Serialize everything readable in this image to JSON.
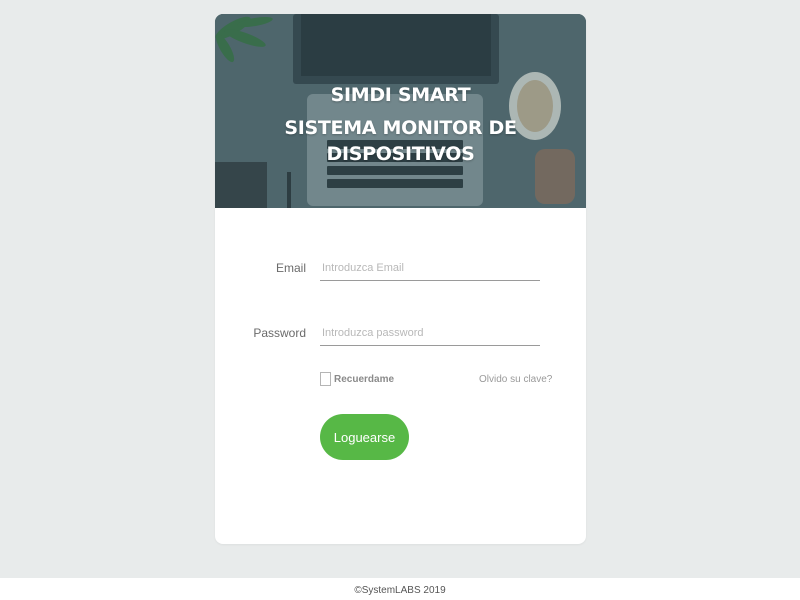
{
  "hero": {
    "title_line1": "SIMDI SMART",
    "title_line2": "SISTEMA MONITOR DE DISPOSITIVOS"
  },
  "form": {
    "email_label": "Email",
    "email_placeholder": "Introduzca Email",
    "email_value": "",
    "password_label": "Password",
    "password_placeholder": "Introduzca password",
    "password_value": "",
    "remember_label": "Recuerdame",
    "remember_checked": false,
    "forgot_label": "Olvido su clave?",
    "submit_label": "Loguearse"
  },
  "footer": {
    "text": "©SystemLABS 2019"
  },
  "colors": {
    "background": "#e8ebeb",
    "card": "#ffffff",
    "accent_button": "#57b846",
    "hero_overlay": "#4f6469"
  },
  "icons": [
    "plant-decoration",
    "laptop-image",
    "coffee-cup-image",
    "checkbox"
  ]
}
